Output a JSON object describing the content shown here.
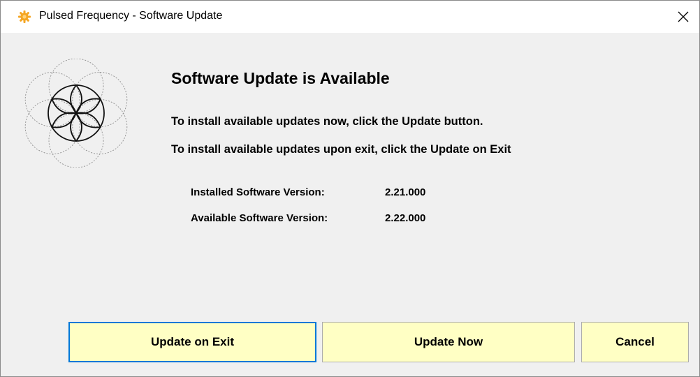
{
  "window": {
    "title": "Pulsed Frequency - Software Update",
    "app_icon": "sun-gear-icon",
    "close_icon": "close-icon"
  },
  "main": {
    "heading": "Software Update is Available",
    "instruction_now": "To install available updates now, click the Update button.",
    "instruction_exit": "To install available updates upon exit, click the Update on Exit",
    "logo": "flower-of-life-logo"
  },
  "versions": {
    "installed_label": "Installed Software Version:",
    "installed_value": "2.21.000",
    "available_label": "Available Software Version:",
    "available_value": "2.22.000"
  },
  "buttons": {
    "update_on_exit": "Update on Exit",
    "update_now": "Update Now",
    "cancel": "Cancel"
  },
  "colors": {
    "button_background": "#ffffc4",
    "focus_border": "#0078d7",
    "dialog_background": "#f0f0f0",
    "icon_orange": "#f5a623"
  }
}
